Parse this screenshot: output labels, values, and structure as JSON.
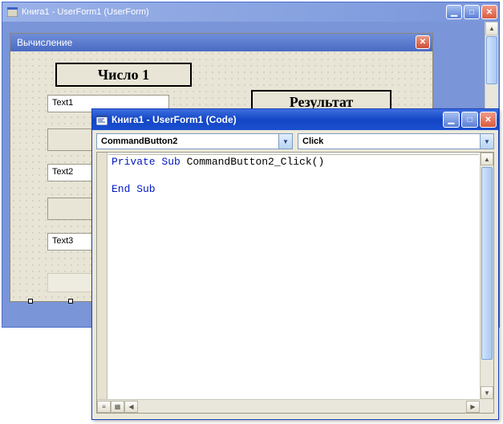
{
  "designer": {
    "title": "Книга1 - UserForm1 (UserForm)",
    "icon": "form-icon"
  },
  "userform": {
    "caption": "Вычисление",
    "labels": {
      "number1": "Число 1",
      "result_partial": "Результат"
    },
    "text1": "Text1",
    "text2": "Text2",
    "text3": "Text3"
  },
  "code_window": {
    "title": "Книга1 - UserForm1 (Code)",
    "object_combo": "CommandButton2",
    "proc_combo": "Click",
    "line1_kw1": "Private Sub",
    "line1_rest": " CommandButton2_Click()",
    "line3_kw": "End Sub"
  },
  "glyphs": {
    "min": "▁",
    "max": "□",
    "close": "✕",
    "up": "▲",
    "down": "▼",
    "left": "◀",
    "right": "▶",
    "caret": "▼"
  }
}
